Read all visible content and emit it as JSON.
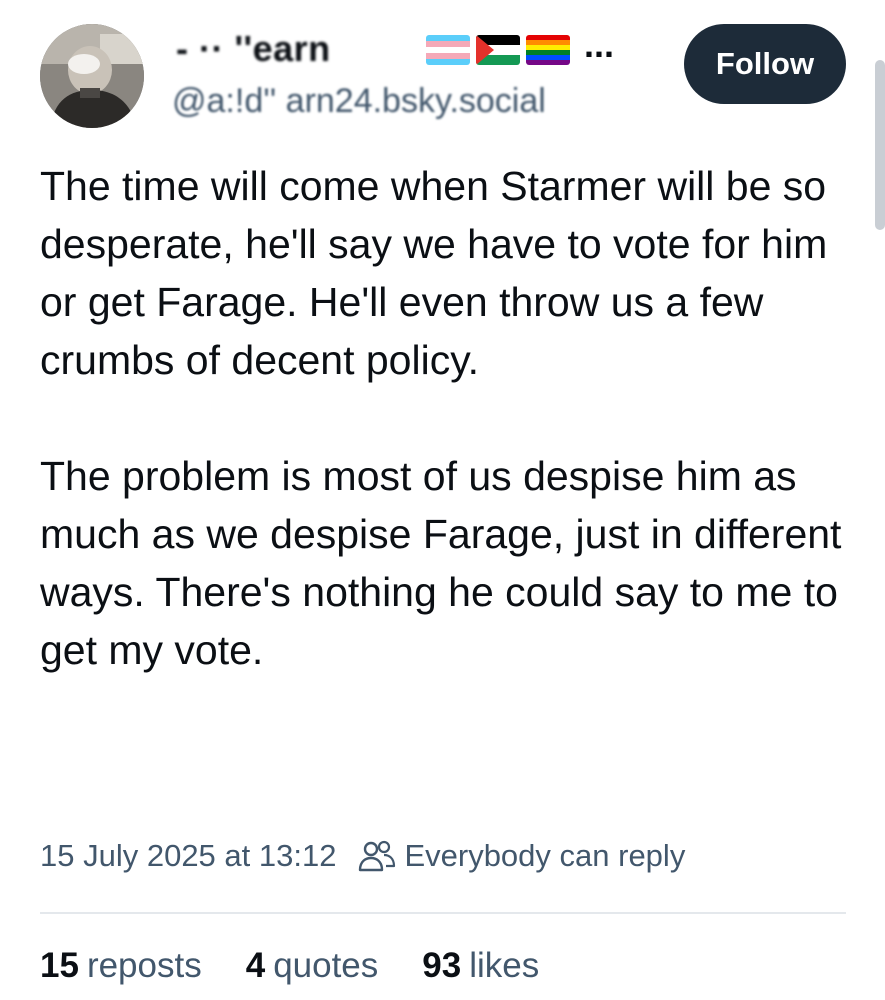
{
  "author": {
    "display_name": "‑ ·· ''earn",
    "flags": [
      "transgender-flag",
      "palestine-flag",
      "rainbow-flag"
    ],
    "name_overflow": "...",
    "handle": "@a:!d'' arn24.bsky.social"
  },
  "follow_button": {
    "label": "Follow"
  },
  "post": {
    "paragraphs": [
      "The time will come when Starmer will be so desperate, he'll say we have to vote for him or get Farage. He'll even throw us a few crumbs of decent policy.",
      "The problem is most of us despise him as much as we despise Farage, just in different ways. There's nothing he could say to me to get my vote."
    ],
    "timestamp": "15 July 2025 at 13:12",
    "reply_setting": "Everybody can reply"
  },
  "stats": {
    "reposts": {
      "count": "15",
      "label": "reposts"
    },
    "quotes": {
      "count": "4",
      "label": "quotes"
    },
    "likes": {
      "count": "93",
      "label": "likes"
    }
  },
  "colors": {
    "follow_bg": "#1d2b39",
    "muted_text": "#42576c",
    "primary_text": "#0b0f14"
  }
}
